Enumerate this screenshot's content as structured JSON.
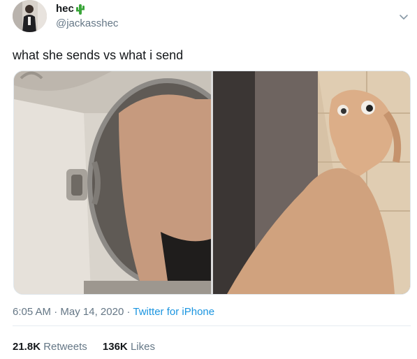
{
  "author": {
    "display_name": "hec",
    "name_emoji": "cactus-emoji",
    "handle": "@jackasshec"
  },
  "tweet": {
    "text": "what she sends vs what i send"
  },
  "media": {
    "left_image": "mirror-photo",
    "right_image": "clay-figure-photo"
  },
  "meta": {
    "time": "6:05 AM",
    "sep1": " · ",
    "date": "May 14, 2020",
    "sep2": " · ",
    "source": "Twitter for iPhone"
  },
  "stats": {
    "retweets_count": "21.8K",
    "retweets_label": "Retweets",
    "likes_count": "136K",
    "likes_label": "Likes"
  },
  "colors": {
    "text": "#14171a",
    "secondary": "#657786",
    "link": "#1b95e0",
    "divider": "#e6ecf0"
  },
  "icons": {
    "menu": "chevron-down-icon"
  }
}
